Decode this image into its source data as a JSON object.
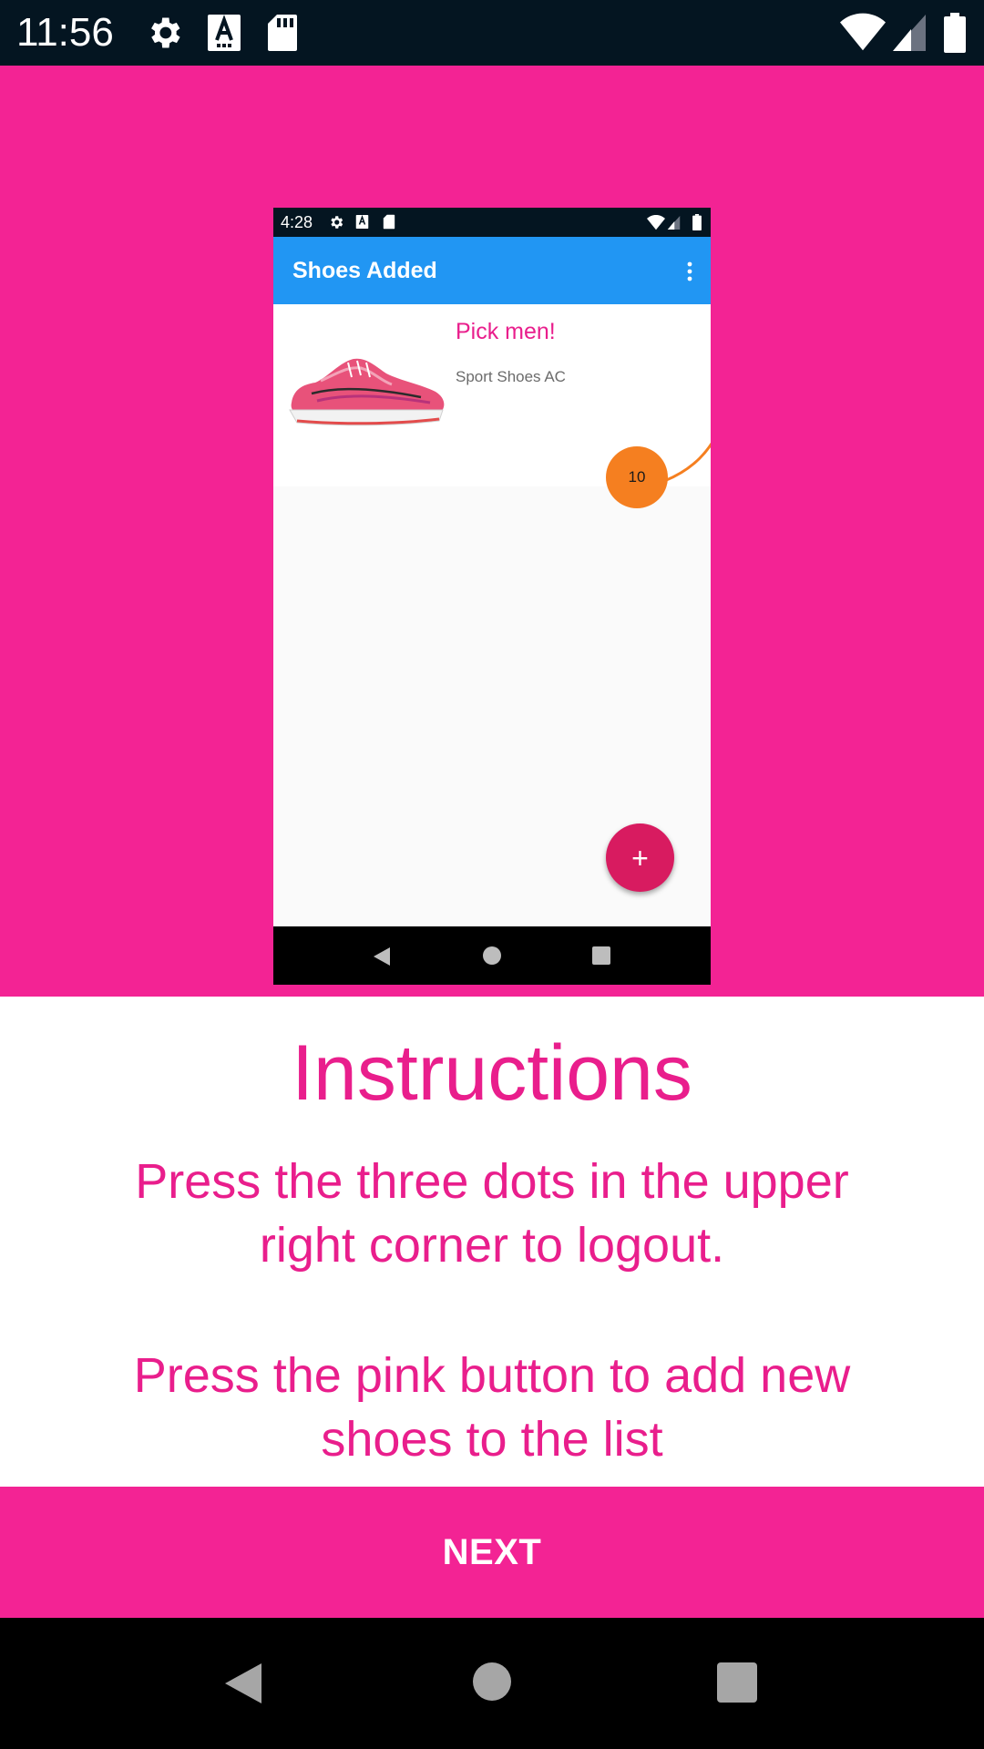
{
  "status_bar": {
    "time": "11:56",
    "icons": [
      "gear-icon",
      "text-a-icon",
      "sd-card-icon",
      "wifi-icon",
      "signal-icon",
      "battery-icon"
    ]
  },
  "preview": {
    "status_time": "4:28",
    "app_bar_title": "Shoes Added",
    "card": {
      "title": "Pick men!",
      "subtitle": "Sport Shoes AC",
      "badge": "10"
    },
    "fab_label": "+",
    "colors": {
      "app_bar": "#2196f3",
      "card_title": "#e91e8c",
      "badge": "#f57f20",
      "fab": "#d81b60"
    }
  },
  "instructions": {
    "title": "Instructions",
    "line1": "Press the three dots in the upper right corner to logout.",
    "line2": "Press the pink button to add new shoes to the list"
  },
  "next_button": {
    "label": "NEXT"
  },
  "nav_bar": {
    "icons": [
      "back-icon",
      "home-icon",
      "recents-icon"
    ]
  },
  "colors": {
    "hero_background": "#f32394",
    "accent_text": "#e91e8c",
    "status_bar": "#041521"
  }
}
